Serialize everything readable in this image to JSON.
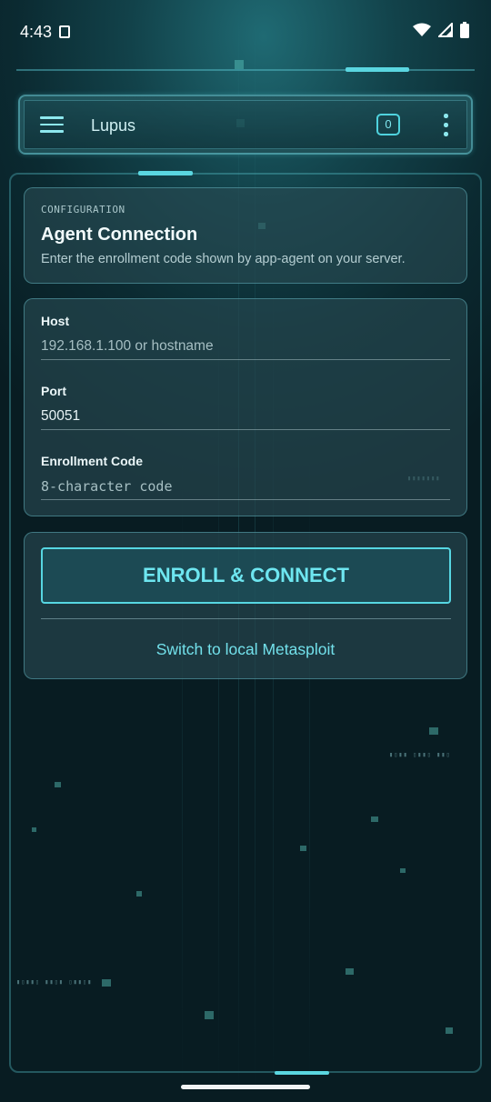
{
  "status_bar": {
    "time": "4:43"
  },
  "app_bar": {
    "title": "Lupus",
    "badge_count": "0"
  },
  "config_card": {
    "eyebrow": "CONFIGURATION",
    "title": "Agent Connection",
    "description": "Enter the enrollment code shown by app-agent on your server."
  },
  "form": {
    "host": {
      "label": "Host",
      "value": "",
      "placeholder": "192.168.1.100 or hostname"
    },
    "port": {
      "label": "Port",
      "value": "50051",
      "placeholder": ""
    },
    "enrollment_code": {
      "label": "Enrollment Code",
      "value": "",
      "placeholder": "8-character code"
    }
  },
  "actions": {
    "enroll_label": "ENROLL & CONNECT",
    "switch_label": "Switch to local Metasploit"
  },
  "colors": {
    "accent": "#56d6e2",
    "background": "#0b2a31",
    "card": "#284b52"
  },
  "icons": [
    "wifi-icon",
    "signal-icon",
    "battery-icon",
    "menu-icon",
    "more-vert-icon",
    "screenshot-icon"
  ]
}
